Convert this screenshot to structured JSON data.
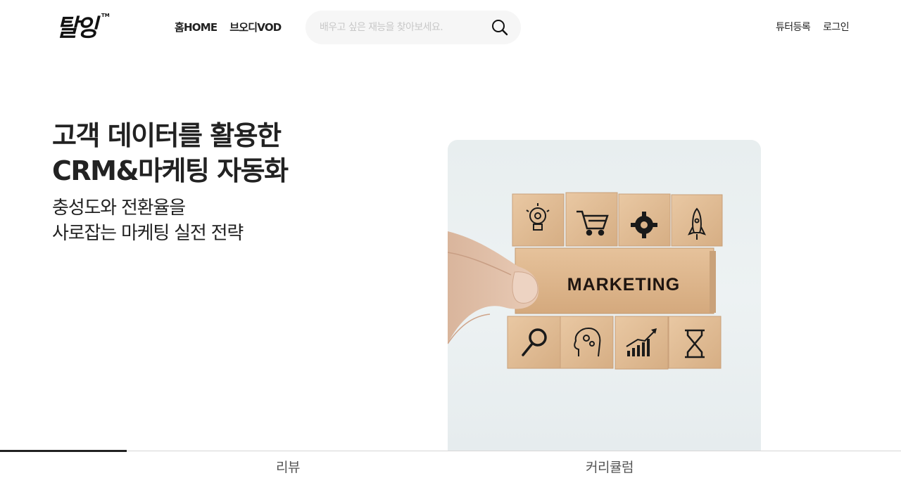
{
  "header": {
    "logo_text": "탈잉",
    "logo_tm": "TM",
    "nav": [
      {
        "label": "홈HOME"
      },
      {
        "label": "브오디VOD"
      }
    ],
    "search": {
      "placeholder": "배우고 싶은 재능을 찾아보세요.",
      "value": ""
    },
    "right_links": [
      {
        "label": "튜터등록"
      },
      {
        "label": "로그인"
      }
    ]
  },
  "hero": {
    "title_line1": "고객 데이터를 활용한",
    "title_line2": "CRM&마케팅 자동화",
    "sub_line1": "충성도와 전환율을",
    "sub_line2": "사로잡는 마케팅 실전 전략",
    "image": {
      "block_text": "MARKETING",
      "icons_top": [
        "lightbulb-gear-icon",
        "shopping-cart-icon",
        "gear-icon",
        "rocket-icon"
      ],
      "icons_bottom": [
        "magnifier-icon",
        "head-gears-icon",
        "growth-chart-icon",
        "hourglass-icon"
      ]
    }
  },
  "tabs": [
    {
      "label": "리뷰"
    },
    {
      "label": "커리큘럼"
    }
  ],
  "colors": {
    "text": "#222222",
    "search_bg": "#f6f6f6",
    "placeholder": "#c8c8c8",
    "wood": "#e2bf99",
    "tab_indicator": "#222222"
  }
}
